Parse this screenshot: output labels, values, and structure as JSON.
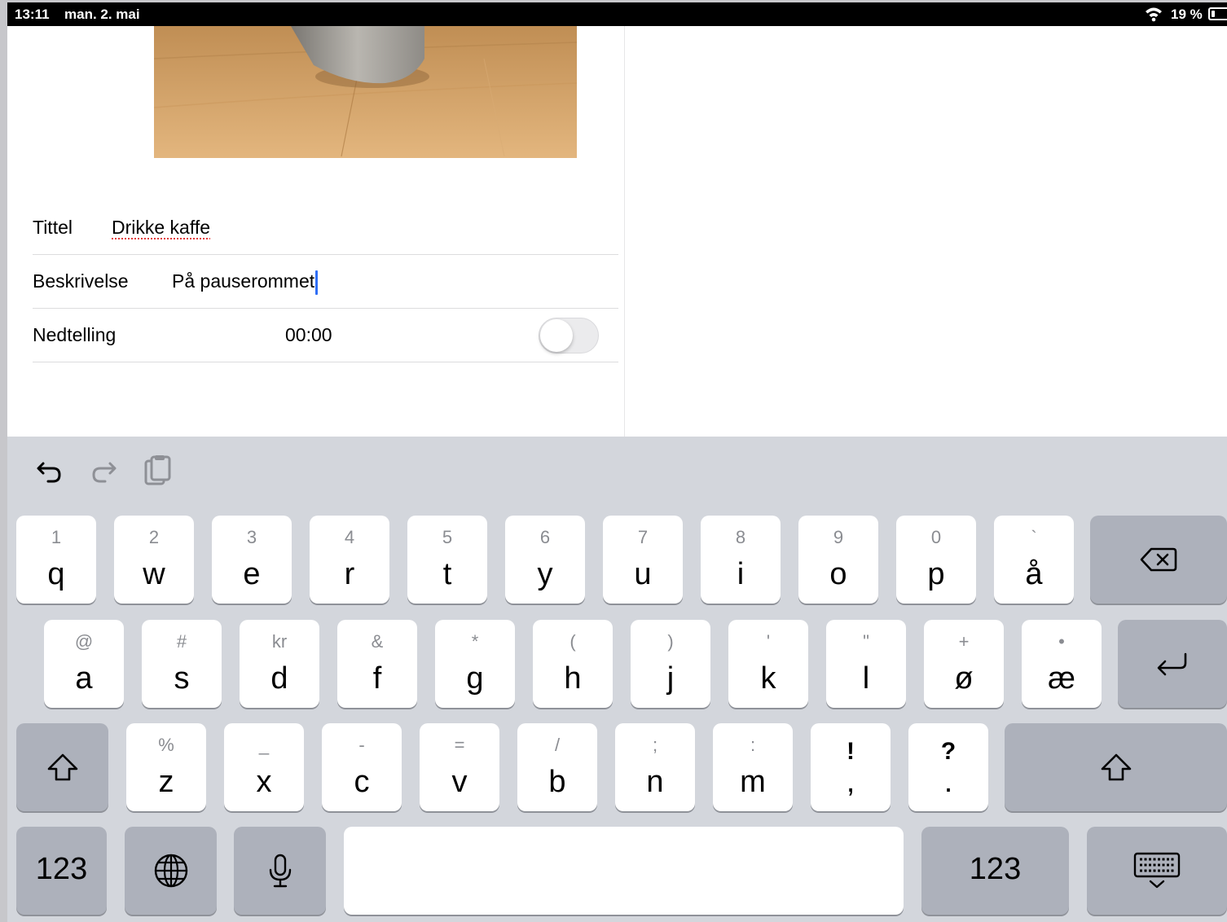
{
  "status_bar": {
    "time": "13:11",
    "date": "man. 2. mai",
    "battery": "19 %"
  },
  "form": {
    "title_label": "Tittel",
    "title_value": "Drikke kaffe",
    "description_label": "Beskrivelse",
    "description_value": "På pauserommet",
    "countdown_label": "Nedtelling",
    "countdown_value": "00:00",
    "countdown_enabled": false
  },
  "shortcuts": [
    "undo-icon",
    "redo-icon",
    "paste-icon"
  ],
  "keyboard": {
    "row1": [
      {
        "main": "q",
        "alt": "1"
      },
      {
        "main": "w",
        "alt": "2"
      },
      {
        "main": "e",
        "alt": "3"
      },
      {
        "main": "r",
        "alt": "4"
      },
      {
        "main": "t",
        "alt": "5"
      },
      {
        "main": "y",
        "alt": "6"
      },
      {
        "main": "u",
        "alt": "7"
      },
      {
        "main": "i",
        "alt": "8"
      },
      {
        "main": "o",
        "alt": "9"
      },
      {
        "main": "p",
        "alt": "0"
      },
      {
        "main": "å",
        "alt": "`"
      }
    ],
    "row2": [
      {
        "main": "a",
        "alt": "@"
      },
      {
        "main": "s",
        "alt": "#"
      },
      {
        "main": "d",
        "alt": "kr"
      },
      {
        "main": "f",
        "alt": "&"
      },
      {
        "main": "g",
        "alt": "*"
      },
      {
        "main": "h",
        "alt": "("
      },
      {
        "main": "j",
        "alt": ")"
      },
      {
        "main": "k",
        "alt": "'"
      },
      {
        "main": "l",
        "alt": "\""
      },
      {
        "main": "ø",
        "alt": "+"
      },
      {
        "main": "æ",
        "alt": "•"
      }
    ],
    "row3": [
      {
        "main": "z",
        "alt": "%"
      },
      {
        "main": "x",
        "alt": "_"
      },
      {
        "main": "c",
        "alt": "-"
      },
      {
        "main": "v",
        "alt": "="
      },
      {
        "main": "b",
        "alt": "/"
      },
      {
        "main": "n",
        "alt": ";"
      },
      {
        "main": "m",
        "alt": ":"
      },
      {
        "main": ",",
        "alt": "!"
      },
      {
        "main": ".",
        "alt": "?"
      }
    ],
    "numbers_left": "123",
    "numbers_right": "123"
  }
}
